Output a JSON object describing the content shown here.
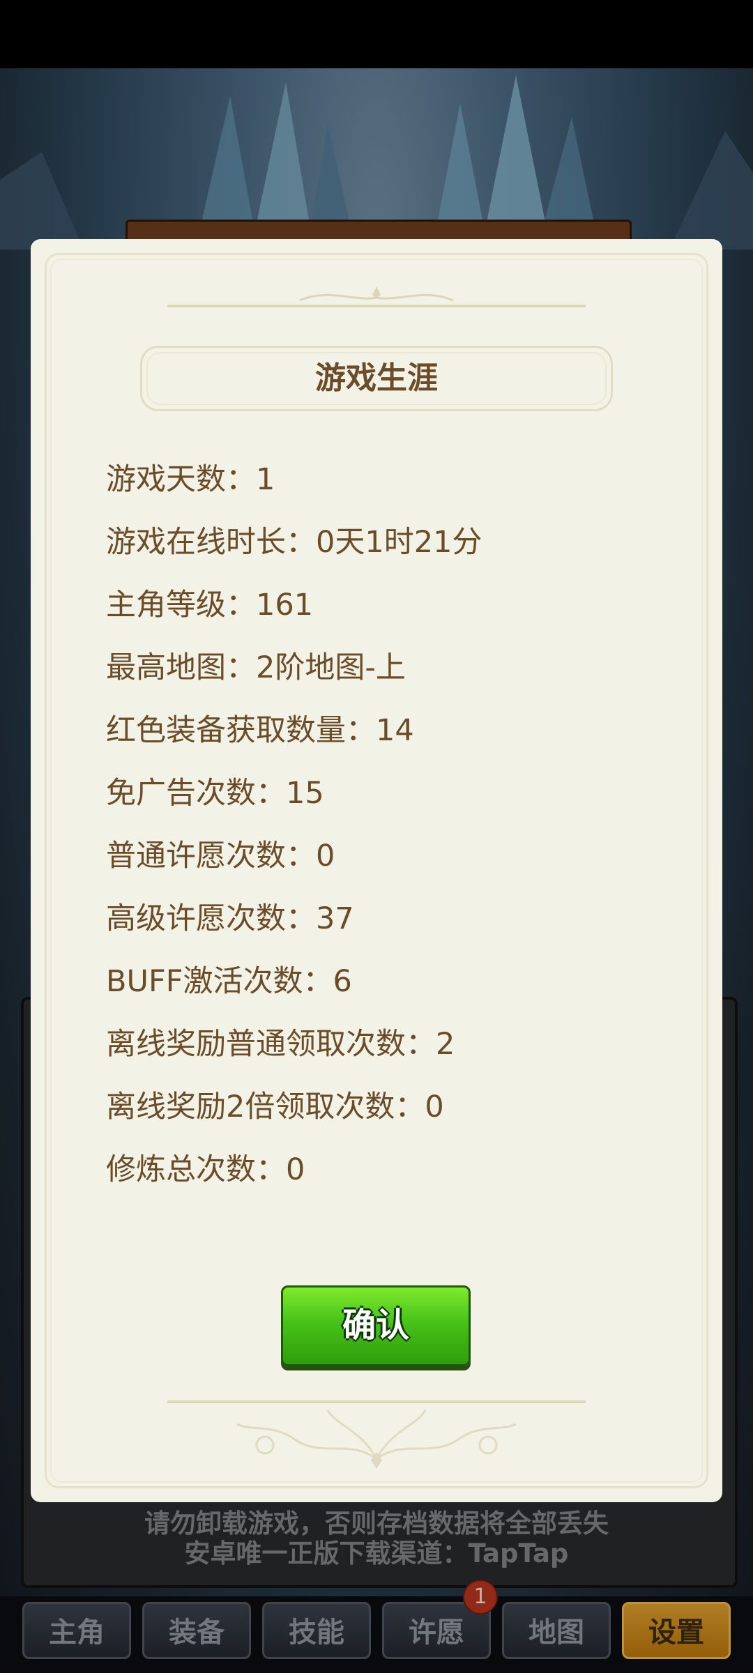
{
  "background": {
    "notice_line1": "请勿卸载游戏，否则存档数据将全部丢失",
    "notice_line2": "安卓唯一正版下载渠道：TapTap"
  },
  "tabs": [
    {
      "label": "主角"
    },
    {
      "label": "装备"
    },
    {
      "label": "技能"
    },
    {
      "label": "许愿",
      "badge": "1"
    },
    {
      "label": "地图"
    },
    {
      "label": "设置",
      "active": true
    }
  ],
  "dialog": {
    "title": "游戏生涯",
    "stats": [
      "游戏天数：1",
      "游戏在线时长：0天1时21分",
      "主角等级：161",
      "最高地图：2阶地图-上",
      "红色装备获取数量：14",
      "免广告次数：15",
      "普通许愿次数：0",
      "高级许愿次数：37",
      "BUFF激活次数：6",
      "离线奖励普通领取次数：2",
      "离线奖励2倍领取次数：0",
      "修炼总次数：0"
    ],
    "confirm_label": "确认"
  },
  "colors": {
    "dialog_bg": "#f3f2e7",
    "text_brown": "#6a4c29",
    "confirm_green": "#48c21a",
    "active_tab": "#d69a2a"
  }
}
